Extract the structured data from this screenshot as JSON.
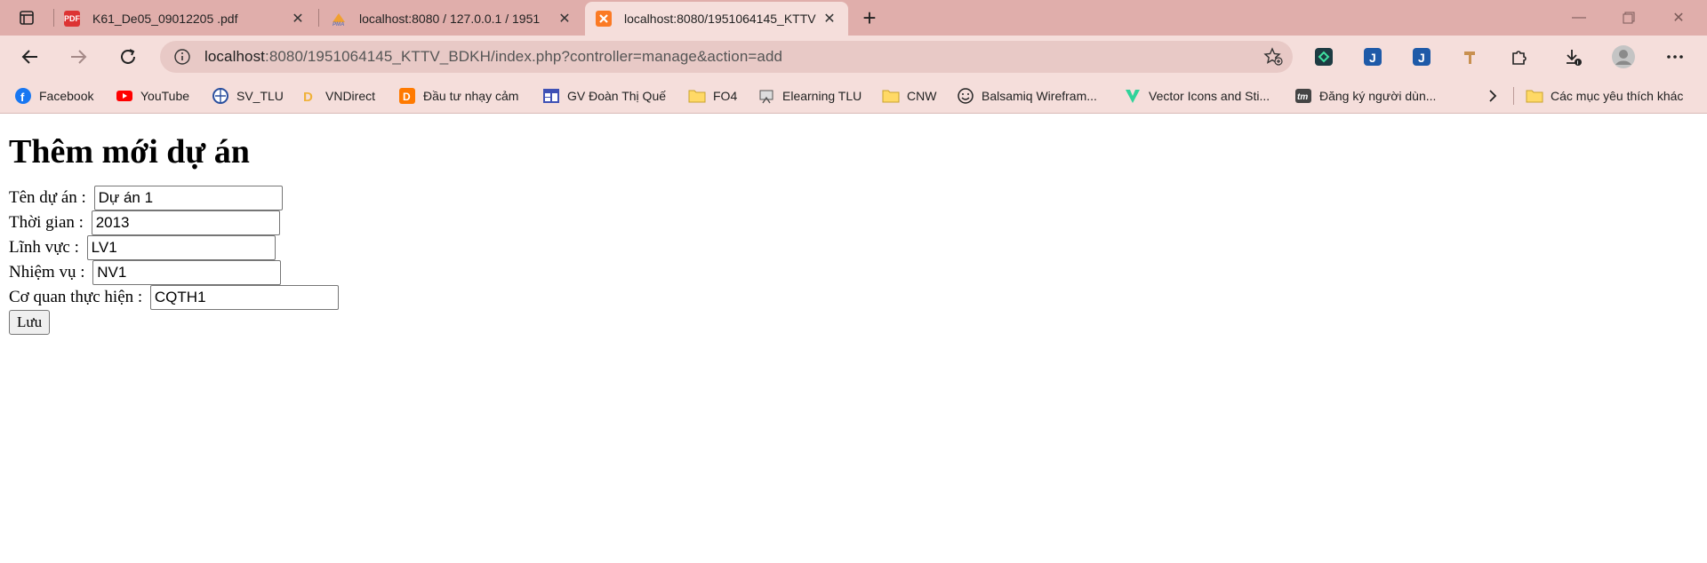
{
  "browser": {
    "tabs": [
      {
        "title": "K61_De05_09012205 .pdf",
        "icon": "pdf-icon",
        "active": false
      },
      {
        "title": "localhost:8080 / 127.0.0.1 / 1951",
        "icon": "phpmyadmin-icon",
        "active": false
      },
      {
        "title": "localhost:8080/1951064145_KTTV",
        "icon": "xampp-icon",
        "active": true
      }
    ],
    "new_tab_label": "+",
    "url_host": "localhost",
    "url_rest": ":8080/1951064145_KTTV_BDKH/index.php?controller=manage&action=add"
  },
  "bookmarks": [
    {
      "label": "Facebook",
      "icon": "facebook-icon"
    },
    {
      "label": "YouTube",
      "icon": "youtube-icon"
    },
    {
      "label": "SV_TLU",
      "icon": "globe-icon"
    },
    {
      "label": "VNDirect",
      "icon": "vndirect-icon"
    },
    {
      "label": "Đầu tư nhạy cảm",
      "icon": "dnse-icon"
    },
    {
      "label": "GV Đoàn Thị Quế",
      "icon": "calendar-icon"
    },
    {
      "label": "FO4",
      "icon": "folder-icon"
    },
    {
      "label": "Elearning TLU",
      "icon": "elearning-icon"
    },
    {
      "label": "CNW",
      "icon": "folder-icon"
    },
    {
      "label": "Balsamiq Wirefram...",
      "icon": "smiley-icon"
    },
    {
      "label": "Vector Icons and Sti...",
      "icon": "vector-icon"
    },
    {
      "label": "Đăng ký người dùn...",
      "icon": "tm-icon"
    },
    {
      "label": "Các mục yêu thích khác",
      "icon": "folder-icon"
    }
  ],
  "page": {
    "title": "Thêm mới dự án",
    "fields": [
      {
        "label": "Tên dự án : ",
        "value": "Dự án 1"
      },
      {
        "label": "Thời gian : ",
        "value": "2013"
      },
      {
        "label": "Lĩnh vực : ",
        "value": "LV1"
      },
      {
        "label": "Nhiệm vụ : ",
        "value": "NV1"
      },
      {
        "label": "Cơ quan thực hiện : ",
        "value": "CQTH1"
      }
    ],
    "save_label": "Lưu"
  },
  "colors": {
    "tabstrip": "#e0aeab",
    "toolbar": "#f5dedb",
    "omnibox": "#e8c9c6"
  }
}
